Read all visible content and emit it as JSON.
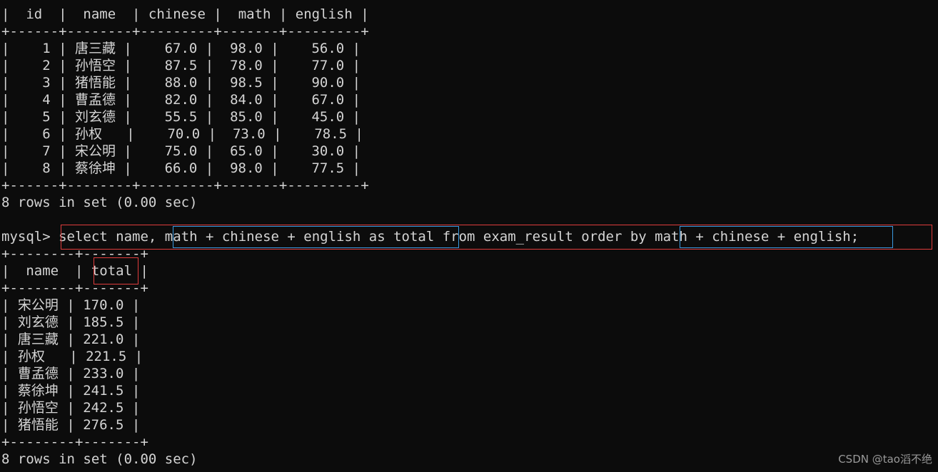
{
  "terminal": {
    "background_color": "#0c0c0c",
    "text_color": "#d4d4d4",
    "prompt": "mysql>",
    "watermark": "CSDN @tao滔不绝"
  },
  "result_1": {
    "separator": "+------+--------+---------+-------+---------+",
    "header": "|  id  |  name  | chinese |  math | english |",
    "rows": [
      "|    1 | 唐三藏 |    67.0 |  98.0 |    56.0 |",
      "|    2 | 孙悟空 |    87.5 |  78.0 |    77.0 |",
      "|    3 | 猪悟能 |    88.0 |  98.5 |    90.0 |",
      "|    4 | 曹孟德 |    82.0 |  84.0 |    67.0 |",
      "|    5 | 刘玄德 |    55.5 |  85.0 |    45.0 |",
      "|    6 | 孙权   |    70.0 |  73.0 |    78.5 |",
      "|    7 | 宋公明 |    75.0 |  65.0 |    30.0 |",
      "|    8 | 蔡徐坤 |    66.0 |  98.0 |    77.5 |"
    ],
    "columns": [
      "id",
      "name",
      "chinese",
      "math",
      "english"
    ],
    "data": [
      {
        "id": 1,
        "name": "唐三藏",
        "chinese": 67.0,
        "math": 98.0,
        "english": 56.0
      },
      {
        "id": 2,
        "name": "孙悟空",
        "chinese": 87.5,
        "math": 78.0,
        "english": 77.0
      },
      {
        "id": 3,
        "name": "猪悟能",
        "chinese": 88.0,
        "math": 98.5,
        "english": 90.0
      },
      {
        "id": 4,
        "name": "曹孟德",
        "chinese": 82.0,
        "math": 84.0,
        "english": 67.0
      },
      {
        "id": 5,
        "name": "刘玄德",
        "chinese": 55.5,
        "math": 85.0,
        "english": 45.0
      },
      {
        "id": 6,
        "name": "孙权",
        "chinese": 70.0,
        "math": 73.0,
        "english": 78.5
      },
      {
        "id": 7,
        "name": "宋公明",
        "chinese": 75.0,
        "math": 65.0,
        "english": 30.0
      },
      {
        "id": 8,
        "name": "蔡徐坤",
        "chinese": 66.0,
        "math": 98.0,
        "english": 77.5
      }
    ],
    "footer": "8 rows in set (0.00 sec)"
  },
  "query": {
    "prompt": "mysql> ",
    "part_select": "select name, ",
    "part_expr1": "math + chinese + english as total",
    "part_middle": " from exam_result order by ",
    "part_expr2": "math + chinese + english",
    "part_end": ";",
    "full_text": "select name, math + chinese + english as total from exam_result order by math + chinese + english;"
  },
  "result_2": {
    "separator": "+--------+-------+",
    "header_left": "|  name  | ",
    "header_total": "total",
    "header_right": " |",
    "columns": [
      "name",
      "total"
    ],
    "rows": [
      "| 宋公明 | 170.0 |",
      "| 刘玄德 | 185.5 |",
      "| 唐三藏 | 221.0 |",
      "| 孙权   | 221.5 |",
      "| 曹孟德 | 233.0 |",
      "| 蔡徐坤 | 241.5 |",
      "| 孙悟空 | 242.5 |",
      "| 猪悟能 | 276.5 |"
    ],
    "data": [
      {
        "name": "宋公明",
        "total": 170.0
      },
      {
        "name": "刘玄德",
        "total": 185.5
      },
      {
        "name": "唐三藏",
        "total": 221.0
      },
      {
        "name": "孙权",
        "total": 221.5
      },
      {
        "name": "曹孟德",
        "total": 233.0
      },
      {
        "name": "蔡徐坤",
        "total": 241.5
      },
      {
        "name": "孙悟空",
        "total": 242.5
      },
      {
        "name": "猪悟能",
        "total": 276.5
      }
    ],
    "footer": "8 rows in set (0.00 sec)"
  },
  "annotations": {
    "red_outer_query": {
      "color": "#e03c3c"
    },
    "blue_expr_1": {
      "color": "#3b9ae1"
    },
    "blue_expr_2": {
      "color": "#3b9ae1"
    },
    "red_total_header": {
      "color": "#e03c3c"
    }
  }
}
